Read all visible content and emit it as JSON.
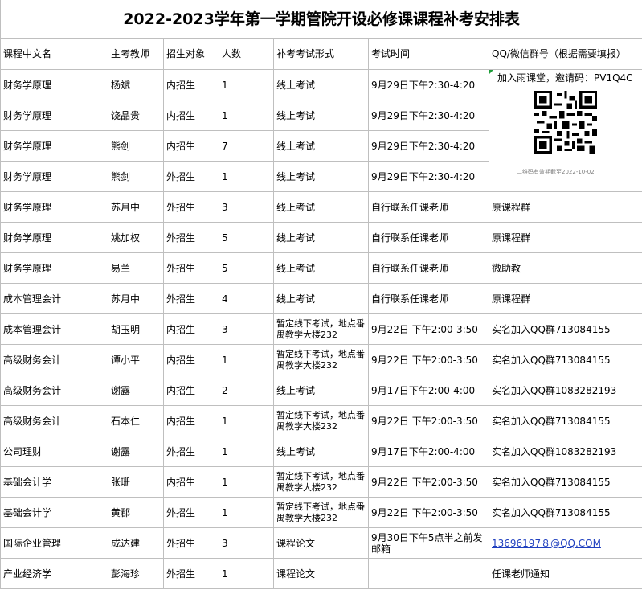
{
  "title": "2022-2023学年第一学期管院开设必修课课程补考安排表",
  "headers": [
    "课程中文名",
    "主考教师",
    "招生对象",
    "人数",
    "补考考试形式",
    "考试时间",
    "QQ/微信群号（根据需要填报）"
  ],
  "qr": {
    "invite": "加入雨课堂，邀请码：PV1Q4C",
    "expire": "二维码有效期截至2022-10-02"
  },
  "rows": [
    {
      "course": "财务学原理",
      "teacher": "杨斌",
      "target": "内招生",
      "count": "1",
      "form": "线上考试",
      "time": "9月29日下午2:30-4:20",
      "group": ""
    },
    {
      "course": "财务学原理",
      "teacher": "饶品贵",
      "target": "内招生",
      "count": "1",
      "form": "线上考试",
      "time": "9月29日下午2:30-4:20",
      "group": ""
    },
    {
      "course": "财务学原理",
      "teacher": "熊剑",
      "target": "内招生",
      "count": "7",
      "form": "线上考试",
      "time": "9月29日下午2:30-4:20",
      "group": ""
    },
    {
      "course": "财务学原理",
      "teacher": "熊剑",
      "target": "外招生",
      "count": "1",
      "form": "线上考试",
      "time": "9月29日下午2:30-4:20",
      "group": ""
    },
    {
      "course": "财务学原理",
      "teacher": "苏月中",
      "target": "外招生",
      "count": "3",
      "form": "线上考试",
      "time": "自行联系任课老师",
      "group": "原课程群"
    },
    {
      "course": "财务学原理",
      "teacher": "姚加权",
      "target": "外招生",
      "count": "5",
      "form": "线上考试",
      "time": "自行联系任课老师",
      "group": "原课程群"
    },
    {
      "course": "财务学原理",
      "teacher": "易兰",
      "target": "外招生",
      "count": "5",
      "form": "线上考试",
      "time": "自行联系任课老师",
      "group": "微助教"
    },
    {
      "course": "成本管理会计",
      "teacher": "苏月中",
      "target": "外招生",
      "count": "4",
      "form": "线上考试",
      "time": "自行联系任课老师",
      "group": "原课程群"
    },
    {
      "course": "成本管理会计",
      "teacher": "胡玉明",
      "target": "内招生",
      "count": "3",
      "form": "暂定线下考试，地点番禺教学大楼232",
      "time": "9月22日 下午2:00-3:50",
      "group": "实名加入QQ群713084155"
    },
    {
      "course": "高级财务会计",
      "teacher": "谭小平",
      "target": "内招生",
      "count": "1",
      "form": "暂定线下考试，地点番禺教学大楼232",
      "time": "9月22日 下午2:00-3:50",
      "group": "实名加入QQ群713084155"
    },
    {
      "course": "高级财务会计",
      "teacher": "谢露",
      "target": "内招生",
      "count": "2",
      "form": "线上考试",
      "time": "9月17日下午2:00-4:00",
      "group": "实名加入QQ群1083282193"
    },
    {
      "course": "高级财务会计",
      "teacher": "石本仁",
      "target": "内招生",
      "count": "1",
      "form": "暂定线下考试，地点番禺教学大楼232",
      "time": "9月22日 下午2:00-3:50",
      "group": "实名加入QQ群713084155"
    },
    {
      "course": "公司理财",
      "teacher": "谢露",
      "target": "外招生",
      "count": "1",
      "form": "线上考试",
      "time": "9月17日下午2:00-4:00",
      "group": "实名加入QQ群1083282193"
    },
    {
      "course": "基础会计学",
      "teacher": "张珊",
      "target": "内招生",
      "count": "1",
      "form": "暂定线下考试，地点番禺教学大楼232",
      "time": "9月22日 下午2:00-3:50",
      "group": "实名加入QQ群713084155"
    },
    {
      "course": "基础会计学",
      "teacher": "黄郡",
      "target": "外招生",
      "count": "1",
      "form": "暂定线下考试，地点番禺教学大楼232",
      "time": "9月22日 下午2:00-3:50",
      "group": "实名加入QQ群713084155"
    },
    {
      "course": "国际企业管理",
      "teacher": "成达建",
      "target": "外招生",
      "count": "3",
      "form": "课程论文",
      "time": "9月30日下午5点半之前发邮箱",
      "group": "13696197８@QQ.COM"
    },
    {
      "course": "产业经济学",
      "teacher": "彭海珍",
      "target": "外招生",
      "count": "1",
      "form": "课程论文",
      "time": "",
      "group": "任课老师通知"
    }
  ]
}
